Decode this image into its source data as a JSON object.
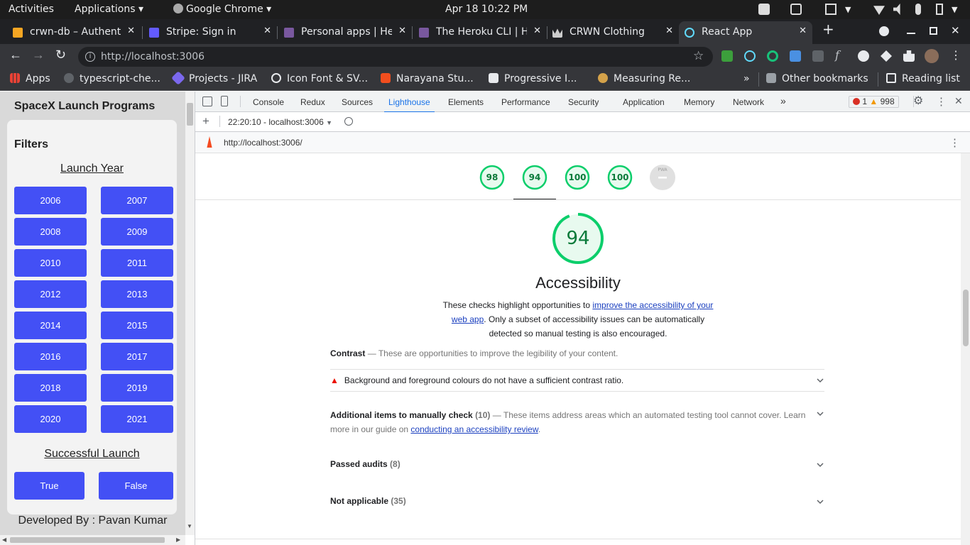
{
  "system_bar": {
    "activities": "Activities",
    "applications": "Applications",
    "app_name": "Google Chrome",
    "datetime": "Apr 18  10:22 PM"
  },
  "tabs": [
    {
      "title": "crwn-db – Authent",
      "color": "#f5a623"
    },
    {
      "title": "Stripe: Sign in",
      "color": "#635bff"
    },
    {
      "title": "Personal apps | He",
      "color": "#79589f"
    },
    {
      "title": "The Heroku CLI | H",
      "color": "#79589f"
    },
    {
      "title": "CRWN Clothing",
      "color": "#cccccc"
    },
    {
      "title": "React App",
      "color": "#61dafb"
    }
  ],
  "toolbar": {
    "url": "http://localhost:3006"
  },
  "bookmarks": {
    "apps": "Apps",
    "items": [
      "typescript-che...",
      "Projects - JIRA",
      "Icon Font & SV...",
      "Narayana Stu...",
      "Progressive I...",
      "Measuring Re..."
    ],
    "other": "Other bookmarks",
    "reading": "Reading list"
  },
  "app": {
    "title": "SpaceX Launch Programs",
    "filters_heading": "Filters",
    "launch_year_heading": "Launch Year",
    "years": [
      "2006",
      "2007",
      "2008",
      "2009",
      "2010",
      "2011",
      "2012",
      "2013",
      "2014",
      "2015",
      "2016",
      "2017",
      "2018",
      "2019",
      "2020",
      "2021"
    ],
    "successful_launch_heading": "Successful Launch",
    "true_label": "True",
    "false_label": "False",
    "footer": "Developed By : Pavan Kumar"
  },
  "devtools": {
    "tabs": [
      "Console",
      "Redux",
      "Sources",
      "Lighthouse",
      "Elements",
      "Performance",
      "Security",
      "Application",
      "Memory",
      "Network"
    ],
    "active_tab": "Lighthouse",
    "errors": "1",
    "warnings": "998",
    "report_select": "22:20:10 - localhost:3006",
    "report_url": "http://localhost:3006/"
  },
  "lighthouse": {
    "scores": [
      98,
      94,
      100,
      100
    ],
    "pwa_label": "PWA",
    "category_score": 94,
    "category_title": "Accessibility",
    "desc_before": "These checks highlight opportunities to ",
    "desc_link": "improve the accessibility of your web app",
    "desc_after": ". Only a subset of accessibility issues can be automatically detected so manual testing is also encouraged.",
    "contrast_title": "Contrast",
    "contrast_desc": "These are opportunities to improve the legibility of your content.",
    "contrast_audit": "Background and foreground colours do not have a sufficient contrast ratio.",
    "manual_title": "Additional items to manually check",
    "manual_count": "(10)",
    "manual_desc": "These items address areas which an automated testing tool cannot cover. Learn more in our guide on ",
    "manual_link": "conducting an accessibility review",
    "passed_title": "Passed audits",
    "passed_count": "(8)",
    "na_title": "Not applicable",
    "na_count": "(35)"
  },
  "colors": {
    "button_blue": "#4350f5",
    "score_green": "#0cce6b",
    "fail_red": "#eb0f00"
  }
}
